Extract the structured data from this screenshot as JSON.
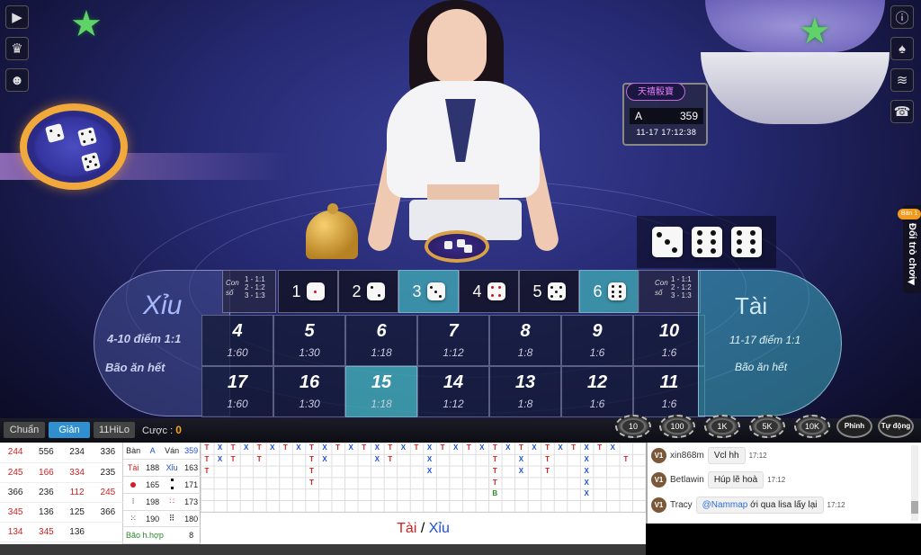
{
  "stand": {
    "logo": "天禧骰寶",
    "table": "A",
    "round": "359",
    "datetime": "11-17 17:12:38"
  },
  "side_tab": {
    "badge": "Bàn 1",
    "label": "Đổi trò chơi",
    "arrow": "◀"
  },
  "big_small": {
    "xiu": {
      "title": "Xỉu",
      "range": "4-10 điểm 1:1",
      "note": "Bão ăn hết"
    },
    "tai": {
      "title": "Tài",
      "range": "11-17 điểm 1:1",
      "note": "Bão ăn hết"
    }
  },
  "combo_left": {
    "a": "Con",
    "b": "số",
    "l1": "1 - 1:1",
    "l2": "2 - 1:2",
    "l3": "3 - 1:3"
  },
  "combo_right": {
    "a": "Con",
    "b": "số",
    "l1": "1 - 1:1",
    "l2": "2 - 1:2",
    "l3": "3 - 1:3"
  },
  "singles": [
    {
      "label": "1",
      "face": 1
    },
    {
      "label": "2",
      "face": 2
    },
    {
      "label": "3",
      "face": 3,
      "highlight": true
    },
    {
      "label": "4",
      "face": 4
    },
    {
      "label": "5",
      "face": 5
    },
    {
      "label": "6",
      "face": 6,
      "highlight": true
    }
  ],
  "totals_top": [
    {
      "n": "4",
      "odds": "1:60"
    },
    {
      "n": "5",
      "odds": "1:30"
    },
    {
      "n": "6",
      "odds": "1:18"
    },
    {
      "n": "7",
      "odds": "1:12"
    },
    {
      "n": "8",
      "odds": "1:8"
    },
    {
      "n": "9",
      "odds": "1:6"
    },
    {
      "n": "10",
      "odds": "1:6"
    }
  ],
  "totals_bottom": [
    {
      "n": "17",
      "odds": "1:60"
    },
    {
      "n": "16",
      "odds": "1:30"
    },
    {
      "n": "15",
      "odds": "1:18",
      "highlight": true
    },
    {
      "n": "14",
      "odds": "1:12"
    },
    {
      "n": "13",
      "odds": "1:8"
    },
    {
      "n": "12",
      "odds": "1:6"
    },
    {
      "n": "11",
      "odds": "1:6"
    }
  ],
  "result_dice": [
    3,
    6,
    6
  ],
  "bet_bar": {
    "tabs": [
      "Chuẩn",
      "Giản",
      "11HiLo"
    ],
    "active_tab": 1,
    "bet_label": "Cược :",
    "bet_value": "0",
    "chips": [
      "10",
      "100",
      "1K",
      "5K",
      "10K"
    ],
    "buttons": [
      "Phỉnh",
      "Tự động"
    ]
  },
  "history": [
    [
      {
        "v": "244",
        "r": true
      },
      {
        "v": "556"
      },
      {
        "v": "234"
      },
      {
        "v": "336"
      }
    ],
    [
      {
        "v": "245",
        "r": true
      },
      {
        "v": "166",
        "r": true
      },
      {
        "v": "334",
        "r": true
      },
      {
        "v": "235"
      }
    ],
    [
      {
        "v": "366"
      },
      {
        "v": "236"
      },
      {
        "v": "112",
        "r": true
      },
      {
        "v": "245",
        "r": true
      }
    ],
    [
      {
        "v": "345",
        "r": true
      },
      {
        "v": "136"
      },
      {
        "v": "125"
      },
      {
        "v": "366"
      }
    ],
    [
      {
        "v": "134",
        "r": true
      },
      {
        "v": "345",
        "r": true
      },
      {
        "v": "136"
      },
      {
        "v": ""
      }
    ]
  ],
  "stats": {
    "row1": {
      "ban": "Bàn",
      "table": "A",
      "van": "Ván",
      "round": "359"
    },
    "row2": {
      "tai": "Tài",
      "tai_count": "188",
      "xiu": "Xỉu",
      "xiu_count": "163"
    },
    "row3": {
      "a_count": "165",
      "b_count": "171"
    },
    "row4": {
      "a_count": "198",
      "b_count": "173"
    },
    "row5": {
      "a_count": "190",
      "b_count": "180"
    },
    "row6": {
      "label": "Bão h.hợp",
      "count": "8"
    }
  },
  "road_grid": {
    "cols": 34,
    "rows": 6,
    "marks": [
      [
        0,
        0,
        "T"
      ],
      [
        1,
        0,
        "X"
      ],
      [
        2,
        0,
        "T"
      ],
      [
        3,
        0,
        "X"
      ],
      [
        4,
        0,
        "T"
      ],
      [
        5,
        0,
        "X"
      ],
      [
        6,
        0,
        "T"
      ],
      [
        7,
        0,
        "X"
      ],
      [
        8,
        0,
        "T"
      ],
      [
        9,
        0,
        "X"
      ],
      [
        10,
        0,
        "T"
      ],
      [
        11,
        0,
        "X"
      ],
      [
        12,
        0,
        "T"
      ],
      [
        13,
        0,
        "X"
      ],
      [
        14,
        0,
        "T"
      ],
      [
        15,
        0,
        "X"
      ],
      [
        16,
        0,
        "T"
      ],
      [
        17,
        0,
        "X"
      ],
      [
        18,
        0,
        "T"
      ],
      [
        19,
        0,
        "X"
      ],
      [
        20,
        0,
        "T"
      ],
      [
        21,
        0,
        "X"
      ],
      [
        22,
        0,
        "T"
      ],
      [
        23,
        0,
        "X"
      ],
      [
        24,
        0,
        "T"
      ],
      [
        25,
        0,
        "X"
      ],
      [
        26,
        0,
        "T"
      ],
      [
        27,
        0,
        "X"
      ],
      [
        28,
        0,
        "T"
      ],
      [
        29,
        0,
        "X"
      ],
      [
        30,
        0,
        "T"
      ],
      [
        31,
        0,
        "X"
      ],
      [
        0,
        1,
        "T"
      ],
      [
        1,
        1,
        "X"
      ],
      [
        2,
        1,
        "T"
      ],
      [
        4,
        1,
        "T"
      ],
      [
        8,
        1,
        "T"
      ],
      [
        9,
        1,
        "X"
      ],
      [
        13,
        1,
        "X"
      ],
      [
        14,
        1,
        "T"
      ],
      [
        17,
        1,
        "X"
      ],
      [
        22,
        1,
        "T"
      ],
      [
        24,
        1,
        "X"
      ],
      [
        26,
        1,
        "T"
      ],
      [
        29,
        1,
        "X"
      ],
      [
        32,
        1,
        "T"
      ],
      [
        0,
        2,
        "T"
      ],
      [
        8,
        2,
        "T"
      ],
      [
        17,
        2,
        "X"
      ],
      [
        22,
        2,
        "T"
      ],
      [
        24,
        2,
        "X"
      ],
      [
        26,
        2,
        "T"
      ],
      [
        29,
        2,
        "X"
      ],
      [
        8,
        3,
        "T"
      ],
      [
        22,
        3,
        "T"
      ],
      [
        29,
        3,
        "X"
      ],
      [
        22,
        4,
        "B"
      ],
      [
        29,
        4,
        "X"
      ]
    ]
  },
  "grid_title": {
    "tai": "Tài",
    "sep": " / ",
    "xiu": "Xỉu"
  },
  "chat": [
    {
      "level": "V1",
      "user": "xin868m",
      "text": "Vcl hh",
      "time": "17:12"
    },
    {
      "level": "V1",
      "user": "Betlawin",
      "text": "Húp lẽ hoà",
      "time": "17:12"
    },
    {
      "level": "V1",
      "user": "Tracy",
      "mention": "@Nammap",
      "text": " ới qua lisa lấy lại",
      "time": "17:12"
    }
  ],
  "colors": {
    "accent": "#2f8fcf",
    "tai": "#d21f1f",
    "xiu": "#1f4fd8",
    "gold": "#f2a71e",
    "teal": "#40a8b4"
  }
}
